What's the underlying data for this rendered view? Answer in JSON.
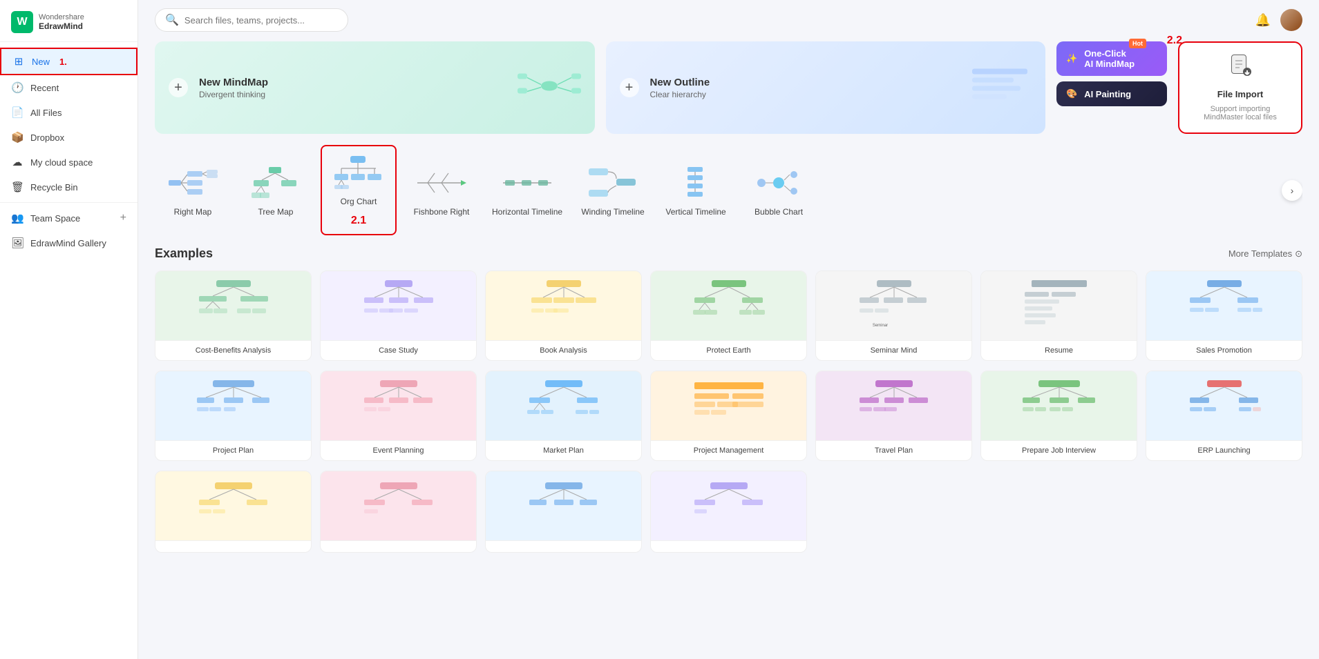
{
  "app": {
    "brand": "Wondershare",
    "product": "EdrawMind"
  },
  "sidebar": {
    "items": [
      {
        "id": "new",
        "label": "New",
        "icon": "⊞",
        "active": true
      },
      {
        "id": "recent",
        "label": "Recent",
        "icon": "🕐"
      },
      {
        "id": "all-files",
        "label": "All Files",
        "icon": "📄"
      },
      {
        "id": "dropbox",
        "label": "Dropbox",
        "icon": "📦"
      },
      {
        "id": "my-cloud",
        "label": "My cloud space",
        "icon": "☁"
      },
      {
        "id": "recycle-bin",
        "label": "Recycle Bin",
        "icon": "🗑"
      }
    ],
    "team_space": "Team Space",
    "gallery": "EdrawMind Gallery"
  },
  "topbar": {
    "search_placeholder": "Search files, teams, projects..."
  },
  "annotations": {
    "label_1": "1.",
    "label_21": "2.1",
    "label_22": "2.2"
  },
  "create_cards": [
    {
      "id": "new-mindmap",
      "title": "New MindMap",
      "subtitle": "Divergent thinking",
      "type": "mindmap"
    },
    {
      "id": "new-outline",
      "title": "New Outline",
      "subtitle": "Clear hierarchy",
      "type": "outline"
    }
  ],
  "ai_cards": [
    {
      "id": "one-click-ai",
      "title": "One-Click AI MindMap",
      "hot": true,
      "type": "ai-mindmap"
    },
    {
      "id": "ai-painting",
      "title": "AI Painting",
      "type": "ai-painting"
    }
  ],
  "file_import": {
    "title": "File Import",
    "subtitle": "Support importing MindMaster local files"
  },
  "templates": [
    {
      "id": "right-map",
      "label": "Right Map"
    },
    {
      "id": "tree-map",
      "label": "Tree Map"
    },
    {
      "id": "org-chart",
      "label": "Org Chart",
      "selected": true
    },
    {
      "id": "fishbone-right",
      "label": "Fishbone Right"
    },
    {
      "id": "horizontal-timeline",
      "label": "Horizontal Timeline"
    },
    {
      "id": "winding-timeline",
      "label": "Winding Timeline"
    },
    {
      "id": "vertical-timeline",
      "label": "Vertical Timeline"
    },
    {
      "id": "bubble-chart",
      "label": "Bubble Chart"
    }
  ],
  "examples": {
    "heading": "Examples",
    "more_templates_label": "More Templates",
    "row1": [
      {
        "id": "cost-benefits",
        "label": "Cost-Benefits Analysis",
        "color": "#e8f5e9"
      },
      {
        "id": "case-study",
        "label": "Case Study",
        "color": "#f3f0ff"
      },
      {
        "id": "book-analysis",
        "label": "Book Analysis",
        "color": "#fff8e1"
      },
      {
        "id": "protect-earth",
        "label": "Protect Earth",
        "color": "#e8f5e9"
      },
      {
        "id": "seminar-mind",
        "label": "Seminar Mind",
        "color": "#f5f5f5"
      },
      {
        "id": "resume",
        "label": "Resume",
        "color": "#f5f5f5"
      },
      {
        "id": "sales-promotion",
        "label": "Sales Promotion",
        "color": "#e8f4ff"
      }
    ],
    "row2": [
      {
        "id": "project-plan",
        "label": "Project Plan",
        "color": "#e8f4ff"
      },
      {
        "id": "event-planning",
        "label": "Event Planning",
        "color": "#fce4ec"
      },
      {
        "id": "market-plan",
        "label": "Market Plan",
        "color": "#e3f2fd"
      },
      {
        "id": "project-management",
        "label": "Project Management",
        "color": "#fff3e0"
      },
      {
        "id": "travel-plan",
        "label": "Travel Plan",
        "color": "#f3e5f5"
      },
      {
        "id": "prepare-job-interview",
        "label": "Prepare Job Interview",
        "color": "#e8f5e9"
      },
      {
        "id": "erp-launching",
        "label": "ERP Launching",
        "color": "#e8f4ff"
      }
    ],
    "row3": [
      {
        "id": "row3-1",
        "label": "",
        "color": "#fff8e1"
      },
      {
        "id": "row3-2",
        "label": "",
        "color": "#fce4ec"
      },
      {
        "id": "row3-3",
        "label": "",
        "color": "#e8f4ff"
      },
      {
        "id": "row3-4",
        "label": "",
        "color": "#f3f0ff"
      }
    ]
  }
}
